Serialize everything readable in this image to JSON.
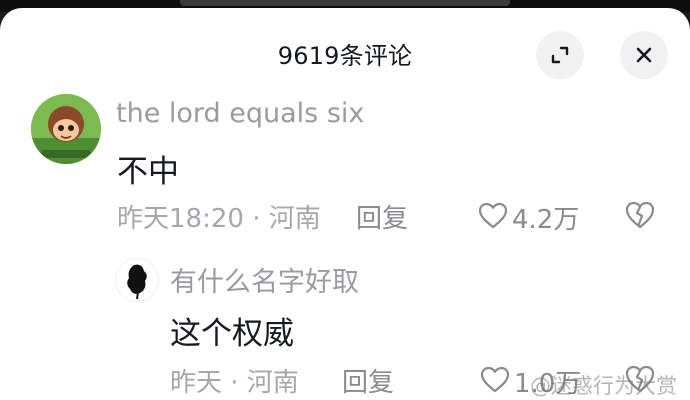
{
  "header": {
    "title": "9619条评论"
  },
  "comments": [
    {
      "username": "the lord equals six",
      "text": "不中",
      "meta": "昨天18:20 · 河南",
      "reply_label": "回复",
      "likes": "4.2万"
    }
  ],
  "replies": [
    {
      "username": "有什么名字好取",
      "text": "这个权威",
      "meta": "昨天 · 河南",
      "reply_label": "回复",
      "likes": "1.0万"
    }
  ],
  "watermark": "@迷惑行为大赏",
  "icons": {
    "expand": "expand-icon",
    "close": "close-icon",
    "like": "heart-outline-icon",
    "dislike": "broken-heart-icon"
  },
  "colors": {
    "text_primary": "#161823",
    "text_secondary": "#9a9aa0",
    "button_bg": "#f1f1f2"
  }
}
